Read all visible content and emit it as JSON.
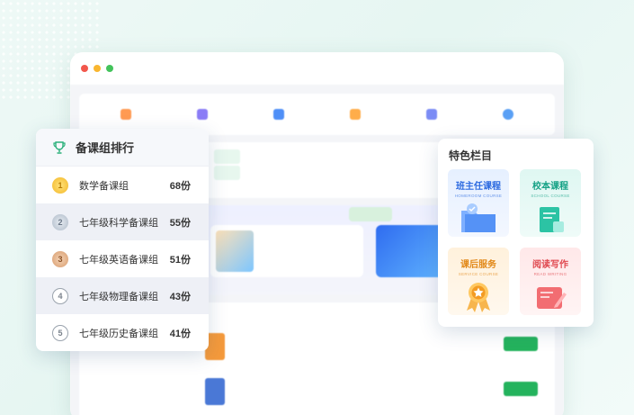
{
  "ranking": {
    "title": "备课组排行",
    "items": [
      {
        "rank": "1",
        "name": "数学备课组",
        "count": "68份"
      },
      {
        "rank": "2",
        "name": "七年级科学备课组",
        "count": "55份"
      },
      {
        "rank": "3",
        "name": "七年级英语备课组",
        "count": "51份"
      },
      {
        "rank": "4",
        "name": "七年级物理备课组",
        "count": "43份"
      },
      {
        "rank": "5",
        "name": "七年级历史备课组",
        "count": "41份"
      }
    ]
  },
  "featured": {
    "title": "特色栏目",
    "tiles": [
      {
        "name": "班主任课程",
        "sub": "HOMEROOM COURSE"
      },
      {
        "name": "校本课程",
        "sub": "SCHOOL COURSE"
      },
      {
        "name": "课后服务",
        "sub": "SERVICE COURSE"
      },
      {
        "name": "阅读写作",
        "sub": "READ WRITING"
      }
    ]
  },
  "colors": {
    "accent_green": "#24b35d",
    "blue": "#2c6ae0",
    "teal": "#16a286",
    "orange": "#e2891a",
    "red": "#e04a50"
  }
}
